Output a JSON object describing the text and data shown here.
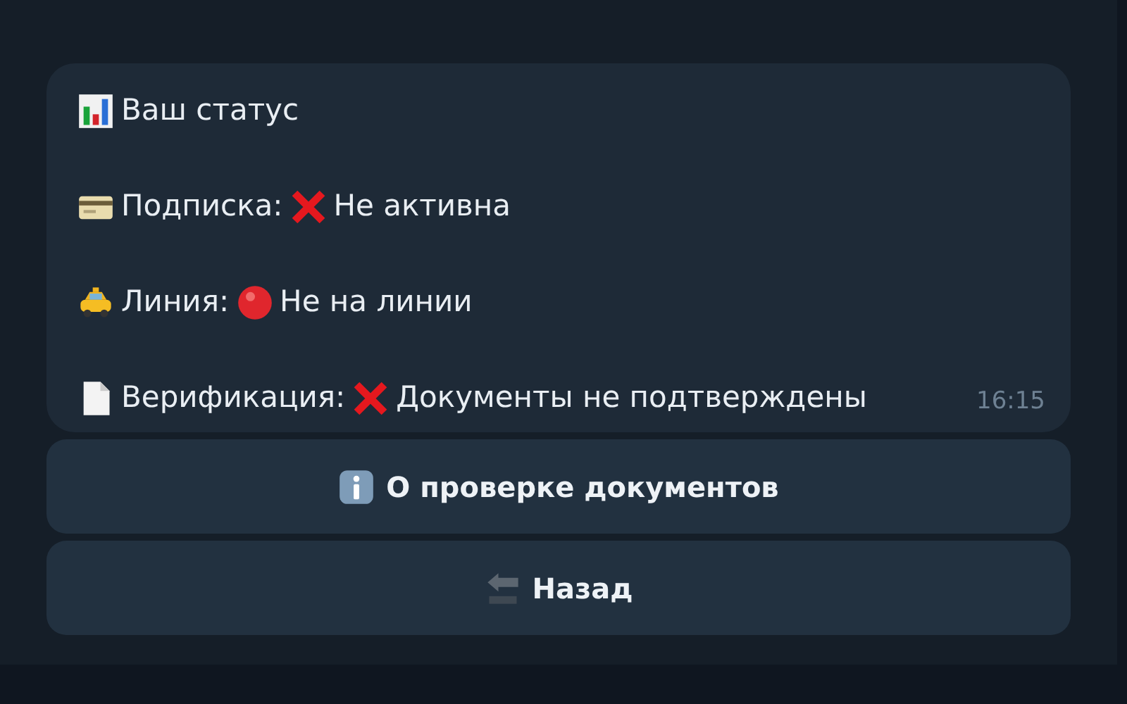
{
  "message": {
    "lines": [
      {
        "label": "Ваш статус"
      },
      {
        "label": "Подписка:",
        "value": "Не активна"
      },
      {
        "label": "Линия:",
        "value": "Не на линии"
      },
      {
        "label": "Верификация:",
        "value": "Документы не подтверждены"
      }
    ],
    "time": "16:15"
  },
  "buttons": [
    {
      "label": "О проверке документов"
    },
    {
      "label": "Назад"
    }
  ]
}
